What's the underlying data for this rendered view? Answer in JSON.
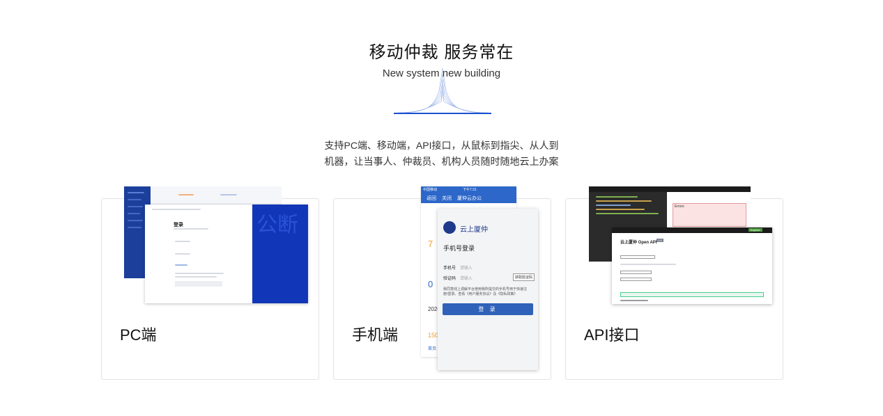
{
  "hero": {
    "title": "移动仲裁 服务常在",
    "subtitle": "New system new building",
    "description_line1": "支持PC端、移动端，API接口，从鼠标到指尖、从人到",
    "description_line2": "机器，让当事人、仲裁员、机构人员随时随地云上办案"
  },
  "cards": [
    {
      "label": "PC端"
    },
    {
      "label": "手机端"
    },
    {
      "label": "API接口"
    }
  ],
  "pc_mock": {
    "login_title": "登录",
    "bg_text": "公断"
  },
  "mobile_mock": {
    "status_left": "中国移动",
    "status_time": "下午7:31",
    "nav_back": "返回",
    "nav_close": "关闭",
    "nav_title": "厦仲云办公",
    "app_name": "云上厦仲",
    "page_title": "手机号登录",
    "phone_label": "手机号",
    "phone_placeholder": "请输入",
    "code_label": "验证码",
    "code_placeholder": "请输入",
    "get_code": "获取验证码",
    "agreement": "我同意线上调解平台使用我所提交的手机号用于快速注册/登录。查看《用户服务协议》及《隐私政策》",
    "login_button": "登 录",
    "back_numbers": [
      "7",
      "0",
      "2020",
      "150"
    ],
    "home_tab": "首页"
  },
  "api_mock": {
    "page_title": "云上厦仲 Open API",
    "version_badge": "1.0",
    "errors_title": "Errors",
    "explore": "Explore"
  },
  "colors": {
    "accent": "#1a4fd0",
    "brand_blue": "#1236b8",
    "mobile_blue": "#2f62b8"
  }
}
